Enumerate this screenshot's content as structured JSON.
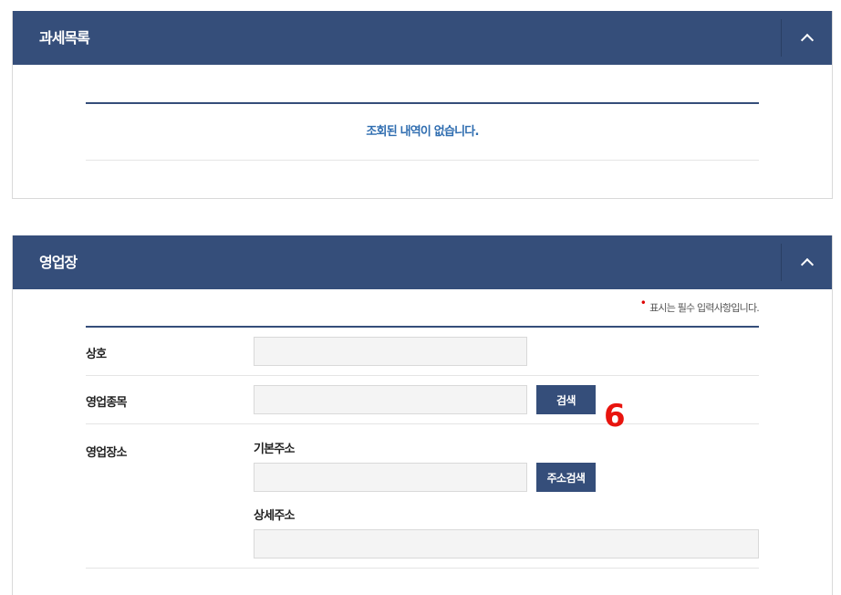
{
  "tax_panel": {
    "title": "과세목록",
    "empty_message": "조회된 내역이 없습니다."
  },
  "business_panel": {
    "title": "영업장",
    "required_mark": "•",
    "required_note": "표시는 필수 입력사항입니다.",
    "rows": {
      "trade_name": {
        "label": "상호",
        "value": ""
      },
      "business_item": {
        "label": "영업종목",
        "value": "",
        "search_label": "검색"
      },
      "business_location": {
        "label": "영업장소",
        "basic_address_label": "기본주소",
        "basic_address_value": "",
        "address_search_label": "주소검색",
        "detail_address_label": "상세주소",
        "detail_address_value": ""
      }
    }
  },
  "annotation": {
    "label": "6",
    "color": "#e8140e"
  },
  "colors": {
    "header_bg": "#354e7a",
    "accent_text": "#2f6db0",
    "field_bg": "#f4f4f4"
  }
}
